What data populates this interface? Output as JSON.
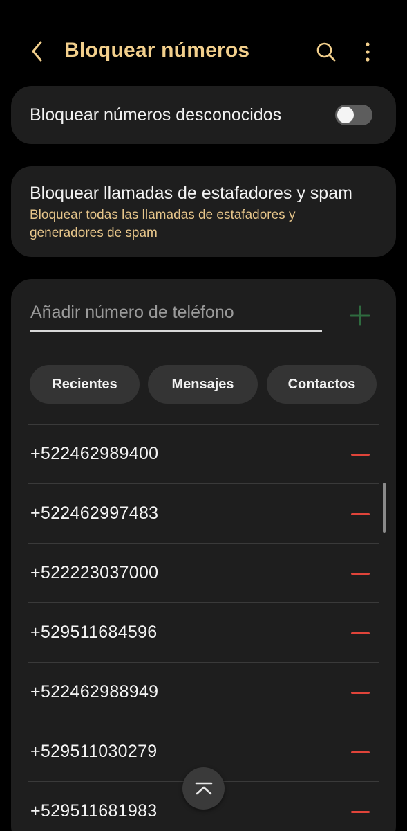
{
  "header": {
    "title": "Bloquear números"
  },
  "unknown_numbers": {
    "label": "Bloquear números desconocidos",
    "enabled": false
  },
  "spam": {
    "title": "Bloquear llamadas de estafadores y spam",
    "subtitle": "Bloquear todas las llamadas de estafadores y generadores de spam"
  },
  "add_number": {
    "placeholder": "Añadir número de teléfono"
  },
  "chips": {
    "recent": "Recientes",
    "messages": "Mensajes",
    "contacts": "Contactos"
  },
  "blocked_numbers": [
    "+522462989400",
    "+522462997483",
    "+522223037000",
    "+529511684596",
    "+522462988949",
    "+529511030279",
    "+529511681983"
  ],
  "icons": {
    "back": "chevron-left-icon",
    "search": "search-icon",
    "more": "more-vertical-icon",
    "add": "plus-icon",
    "remove": "minus-icon",
    "scroll_top": "chevron-up-bar-icon"
  },
  "colors": {
    "accent": "#f2cf8c",
    "subtitle": "#e6c58a",
    "add": "#2f6b3f",
    "remove": "#e0443a"
  }
}
